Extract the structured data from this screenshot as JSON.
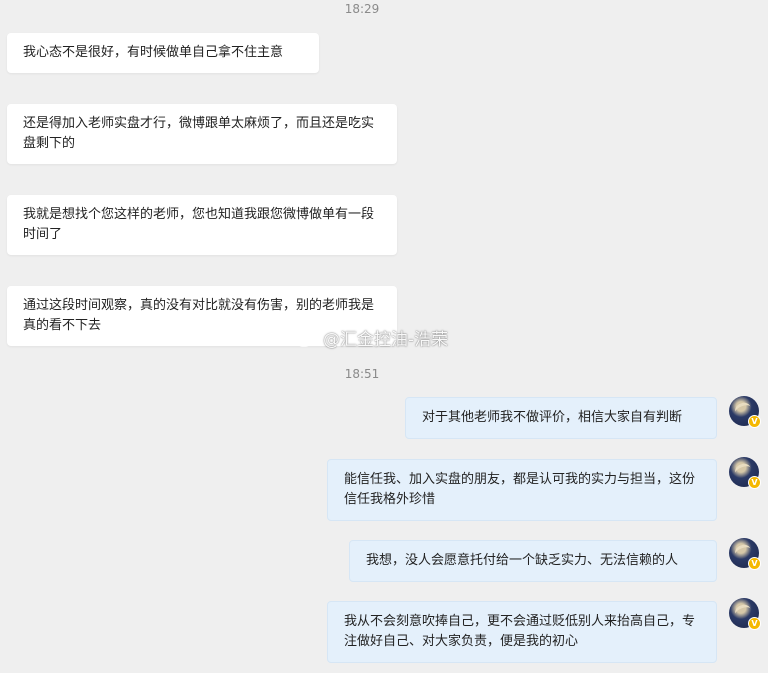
{
  "timestamps": [
    "18:29",
    "18:51"
  ],
  "incoming_messages": [
    "我心态不是很好，有时候做单自己拿不住主意",
    "还是得加入老师实盘才行，微博跟单太麻烦了，而且还是吃实盘剩下的",
    "我就是想找个您这样的老师，您也知道我跟您微博做单有一段时间了",
    "通过这段时间观察，真的没有对比就没有伤害，别的老师我是真的看不下去"
  ],
  "outgoing_messages": [
    "对于其他老师我不做评价，相信大家自有判断",
    "能信任我、加入实盘的朋友，都是认可我的实力与担当，这份信任我格外珍惜",
    "我想，没人会愿意托付给一个缺乏实力、无法信赖的人",
    "我从不会刻意吹捧自己，更不会通过贬低别人来抬高自己，专注做好自己、对大家负责，便是我的初心"
  ],
  "watermark_text": "@汇金控油-浩荣",
  "avatar_badge": "V",
  "colors": {
    "background": "#efefef",
    "incoming_bubble": "#ffffff",
    "outgoing_bubble": "#e4f0fb",
    "timestamp_text": "#8a8a8a",
    "badge": "#f5b800"
  }
}
